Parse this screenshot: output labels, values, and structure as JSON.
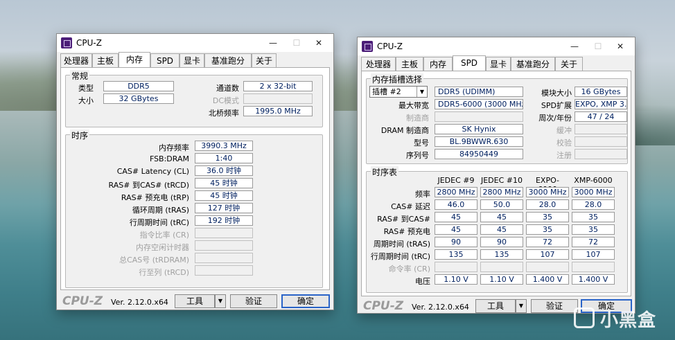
{
  "left": {
    "title": "CPU-Z",
    "tabs": [
      "处理器",
      "主板",
      "内存",
      "SPD",
      "显卡",
      "基准跑分",
      "关于"
    ],
    "active_tab": "内存",
    "general": {
      "title": "常规",
      "type_label": "类型",
      "type_value": "DDR5",
      "size_label": "大小",
      "size_value": "32 GBytes",
      "channels_label": "通道数",
      "channels_value": "2 x 32-bit",
      "dc_label": "DC模式",
      "dc_value": "",
      "nb_label": "北桥频率",
      "nb_value": "1995.0 MHz"
    },
    "timings": {
      "title": "时序",
      "rows": [
        {
          "label": "内存频率",
          "value": "3990.3 MHz"
        },
        {
          "label": "FSB:DRAM",
          "value": "1:40"
        },
        {
          "label": "CAS# Latency (CL)",
          "value": "36.0 时钟"
        },
        {
          "label": "RAS# 到CAS# (tRCD)",
          "value": "45 时钟"
        },
        {
          "label": "RAS# 预充电 (tRP)",
          "value": "45 时钟"
        },
        {
          "label": "循环周期 (tRAS)",
          "value": "127 时钟"
        },
        {
          "label": "行周期时间 (tRC)",
          "value": "192 时钟"
        },
        {
          "label": "指令比率 (CR)",
          "value": ""
        },
        {
          "label": "内存空闲计时器",
          "value": ""
        },
        {
          "label": "总CAS号 (tRDRAM)",
          "value": ""
        },
        {
          "label": "行至列 (tRCD)",
          "value": ""
        }
      ]
    },
    "bottom": {
      "brand": "CPU-Z",
      "version": "Ver. 2.12.0.x64",
      "tools": "工具",
      "validate": "验证",
      "ok": "确定"
    }
  },
  "right": {
    "title": "CPU-Z",
    "tabs": [
      "处理器",
      "主板",
      "内存",
      "SPD",
      "显卡",
      "基准跑分",
      "关于"
    ],
    "active_tab": "SPD",
    "slot": {
      "title": "内存插槽选择",
      "slot_select": "插槽 #2",
      "module_type": "DDR5 (UDIMM)",
      "module_size_label": "模块大小",
      "module_size_value": "16 GBytes",
      "max_bw_label": "最大带宽",
      "max_bw_value": "DDR5-6000 (3000 MHz)",
      "spd_ext_label": "SPD扩展",
      "spd_ext_value": "EXPO, XMP 3.0",
      "mfr_label": "制造商",
      "mfr_value": "",
      "week_year_label": "周次/年份",
      "week_year_value": "47 / 24",
      "dram_mfr_label": "DRAM 制造商",
      "dram_mfr_value": "SK Hynix",
      "buffered_label": "缓冲",
      "buffered_value": "",
      "part_label": "型号",
      "part_value": "BL.9BWWR.630",
      "correction_label": "校验",
      "correction_value": "",
      "serial_label": "序列号",
      "serial_value": "84950449",
      "registered_label": "注册",
      "registered_value": ""
    },
    "timing_table": {
      "title": "时序表",
      "columns": [
        "JEDEC #9",
        "JEDEC #10",
        "EXPO-6000",
        "XMP-6000"
      ],
      "rows": [
        {
          "label": "频率",
          "values": [
            "2800 MHz",
            "2800 MHz",
            "3000 MHz",
            "3000 MHz"
          ]
        },
        {
          "label": "CAS# 延迟",
          "values": [
            "46.0",
            "50.0",
            "28.0",
            "28.0"
          ]
        },
        {
          "label": "RAS# 到CAS#",
          "values": [
            "45",
            "45",
            "35",
            "35"
          ]
        },
        {
          "label": "RAS# 预充电",
          "values": [
            "45",
            "45",
            "35",
            "35"
          ]
        },
        {
          "label": "周期时间 (tRAS)",
          "values": [
            "90",
            "90",
            "72",
            "72"
          ]
        },
        {
          "label": "行周期时间 (tRC)",
          "values": [
            "135",
            "135",
            "107",
            "107"
          ]
        },
        {
          "label": "命令率 (CR)",
          "values": [
            "",
            "",
            "",
            ""
          ]
        },
        {
          "label": "电压",
          "values": [
            "1.10 V",
            "1.10 V",
            "1.400 V",
            "1.400 V"
          ]
        }
      ]
    },
    "bottom": {
      "brand": "CPU-Z",
      "version": "Ver. 2.12.0.x64",
      "tools": "工具",
      "validate": "验证",
      "ok": "确定"
    }
  },
  "watermark": "小黑盒"
}
